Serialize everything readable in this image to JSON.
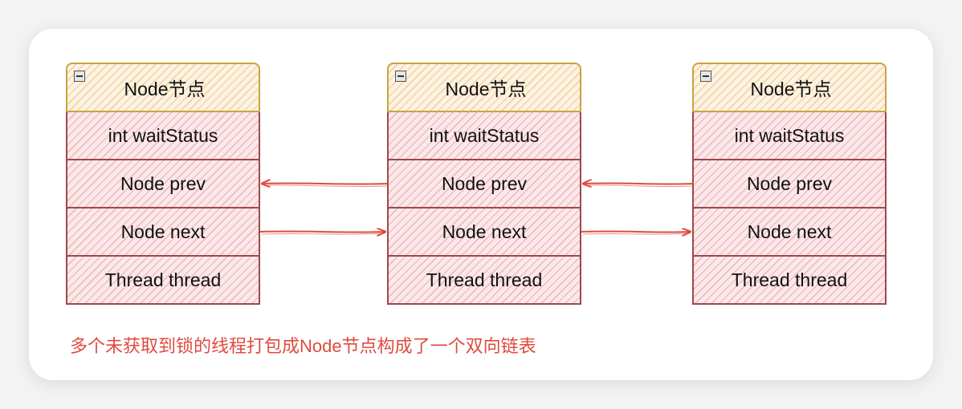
{
  "nodes": [
    {
      "title": "Node节点",
      "fields": [
        "int waitStatus",
        "Node prev",
        "Node next",
        "Thread thread"
      ]
    },
    {
      "title": "Node节点",
      "fields": [
        "int waitStatus",
        "Node prev",
        "Node next",
        "Thread thread"
      ]
    },
    {
      "title": "Node节点",
      "fields": [
        "int waitStatus",
        "Node prev",
        "Node next",
        "Thread thread"
      ]
    }
  ],
  "caption": "多个未获取到锁的线程打包成Node节点构成了一个双向链表",
  "colors": {
    "header_border": "#c9a440",
    "header_fill": "#fdf3e2",
    "field_border": "#a04848",
    "field_fill": "#fbe9ea",
    "arrow": "#e04a3f"
  }
}
